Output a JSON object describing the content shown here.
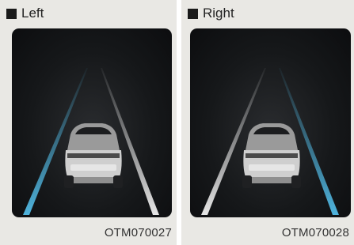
{
  "panels": [
    {
      "heading": "Left",
      "code": "OTM070027",
      "highlighted_lane": "left",
      "highlight_color": "#4fb3dc"
    },
    {
      "heading": "Right",
      "code": "OTM070028",
      "highlighted_lane": "right",
      "highlight_color": "#4fb3dc"
    }
  ],
  "colors": {
    "lane_default": "#d9d9d9",
    "lane_highlight": "#4fb3dc",
    "car_body": "#cfcfcf"
  }
}
